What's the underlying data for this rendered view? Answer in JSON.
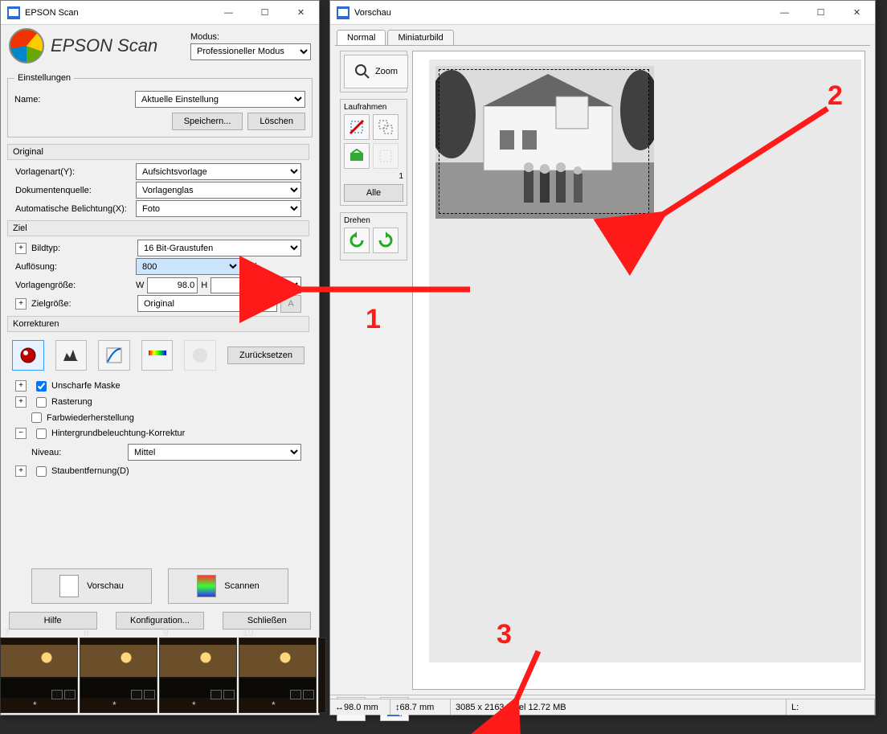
{
  "scanWindow": {
    "title": "EPSON Scan",
    "appTitle": "EPSON Scan",
    "modeLabel": "Modus:",
    "modeValue": "Professioneller Modus",
    "settings": {
      "legend": "Einstellungen",
      "nameLabel": "Name:",
      "nameValue": "Aktuelle Einstellung",
      "saveBtn": "Speichern...",
      "deleteBtn": "Löschen"
    },
    "original": {
      "head": "Original",
      "vorlagenartLabel": "Vorlagenart(Y):",
      "vorlagenartValue": "Aufsichtsvorlage",
      "dokQuelleLabel": "Dokumentenquelle:",
      "dokQuelleValue": "Vorlagenglas",
      "autoBelLabel": "Automatische Belichtung(X):",
      "autoBelValue": "Foto"
    },
    "ziel": {
      "head": "Ziel",
      "bildtypLabel": "Bildtyp:",
      "bildtypValue": "16 Bit-Graustufen",
      "aufloesungLabel": "Auflösung:",
      "aufloesungValue": "800",
      "dpi": "dpi",
      "vorlGroesseLabel": "Vorlagengröße:",
      "w": "W",
      "wVal": "98.0",
      "h": "H",
      "hVal": "68.7",
      "unit": "mm",
      "zielGroesseLabel": "Zielgröße:",
      "zielGroesseValue": "Original"
    },
    "korrekturen": {
      "head": "Korrekturen",
      "reset": "Zurücksetzen",
      "unscharfe": "Unscharfe Maske",
      "rasterung": "Rasterung",
      "farbwieder": "Farbwiederherstellung",
      "hgb": "Hintergrundbeleuchtung-Korrektur",
      "niveauLabel": "Niveau:",
      "niveauValue": "Mittel",
      "staub": "Staubentfernung(D)"
    },
    "vorschauBtn": "Vorschau",
    "scannenBtn": "Scannen",
    "hilfe": "Hilfe",
    "konfig": "Konfiguration...",
    "schliessen": "Schließen"
  },
  "previewWindow": {
    "title": "Vorschau",
    "tabNormal": "Normal",
    "tabMini": "Miniaturbild",
    "zoom": "Zoom",
    "laufrahmen": "Laufrahmen",
    "alle": "Alle",
    "drehen": "Drehen",
    "marqueeCount": "1",
    "status": {
      "w": "98.0 mm",
      "h": "68.7 mm",
      "pixels": "3085 x 2163 Pixel 12.72 MB",
      "l": "L:"
    }
  },
  "thumbs": [
    "7",
    "8",
    "9",
    "10",
    ""
  ],
  "annotations": {
    "a1": "1",
    "a2": "2",
    "a3": "3"
  }
}
